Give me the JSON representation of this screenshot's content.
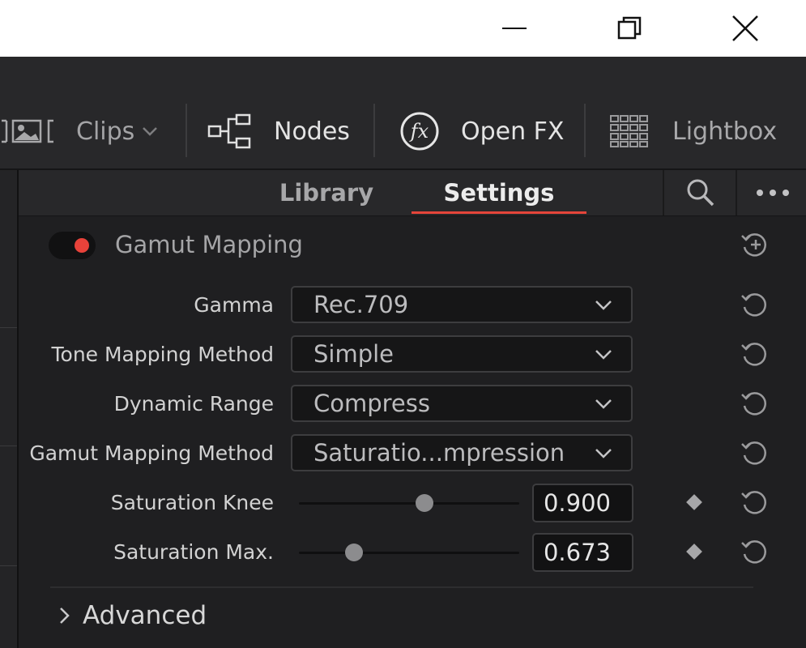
{
  "window_controls": {
    "minimize_icon": "minimize-icon",
    "restore_icon": "restore-icon",
    "close_icon": "close-icon"
  },
  "toolbar": {
    "clips_label": "Clips",
    "nodes_label": "Nodes",
    "openfx_label": "Open FX",
    "lightbox_label": "Lightbox"
  },
  "panel_tabs": {
    "library": "Library",
    "settings": "Settings",
    "active_tab": "Settings"
  },
  "section": {
    "title": "Gamut Mapping",
    "enabled": true,
    "accent_color": "#e8423a"
  },
  "fields": {
    "gamma": {
      "label": "Gamma",
      "value": "Rec.709"
    },
    "tone_mapping": {
      "label": "Tone Mapping Method",
      "value": "Simple"
    },
    "dynamic_range": {
      "label": "Dynamic Range",
      "value": "Compress"
    },
    "gamut_method": {
      "label": "Gamut Mapping Method",
      "value": "Saturatio...mpression"
    },
    "saturation_knee": {
      "label": "Saturation Knee",
      "value": "0.900",
      "slider_fraction": 0.57
    },
    "saturation_max": {
      "label": "Saturation Max.",
      "value": "0.673",
      "slider_fraction": 0.25
    }
  },
  "advanced": {
    "label": "Advanced"
  }
}
